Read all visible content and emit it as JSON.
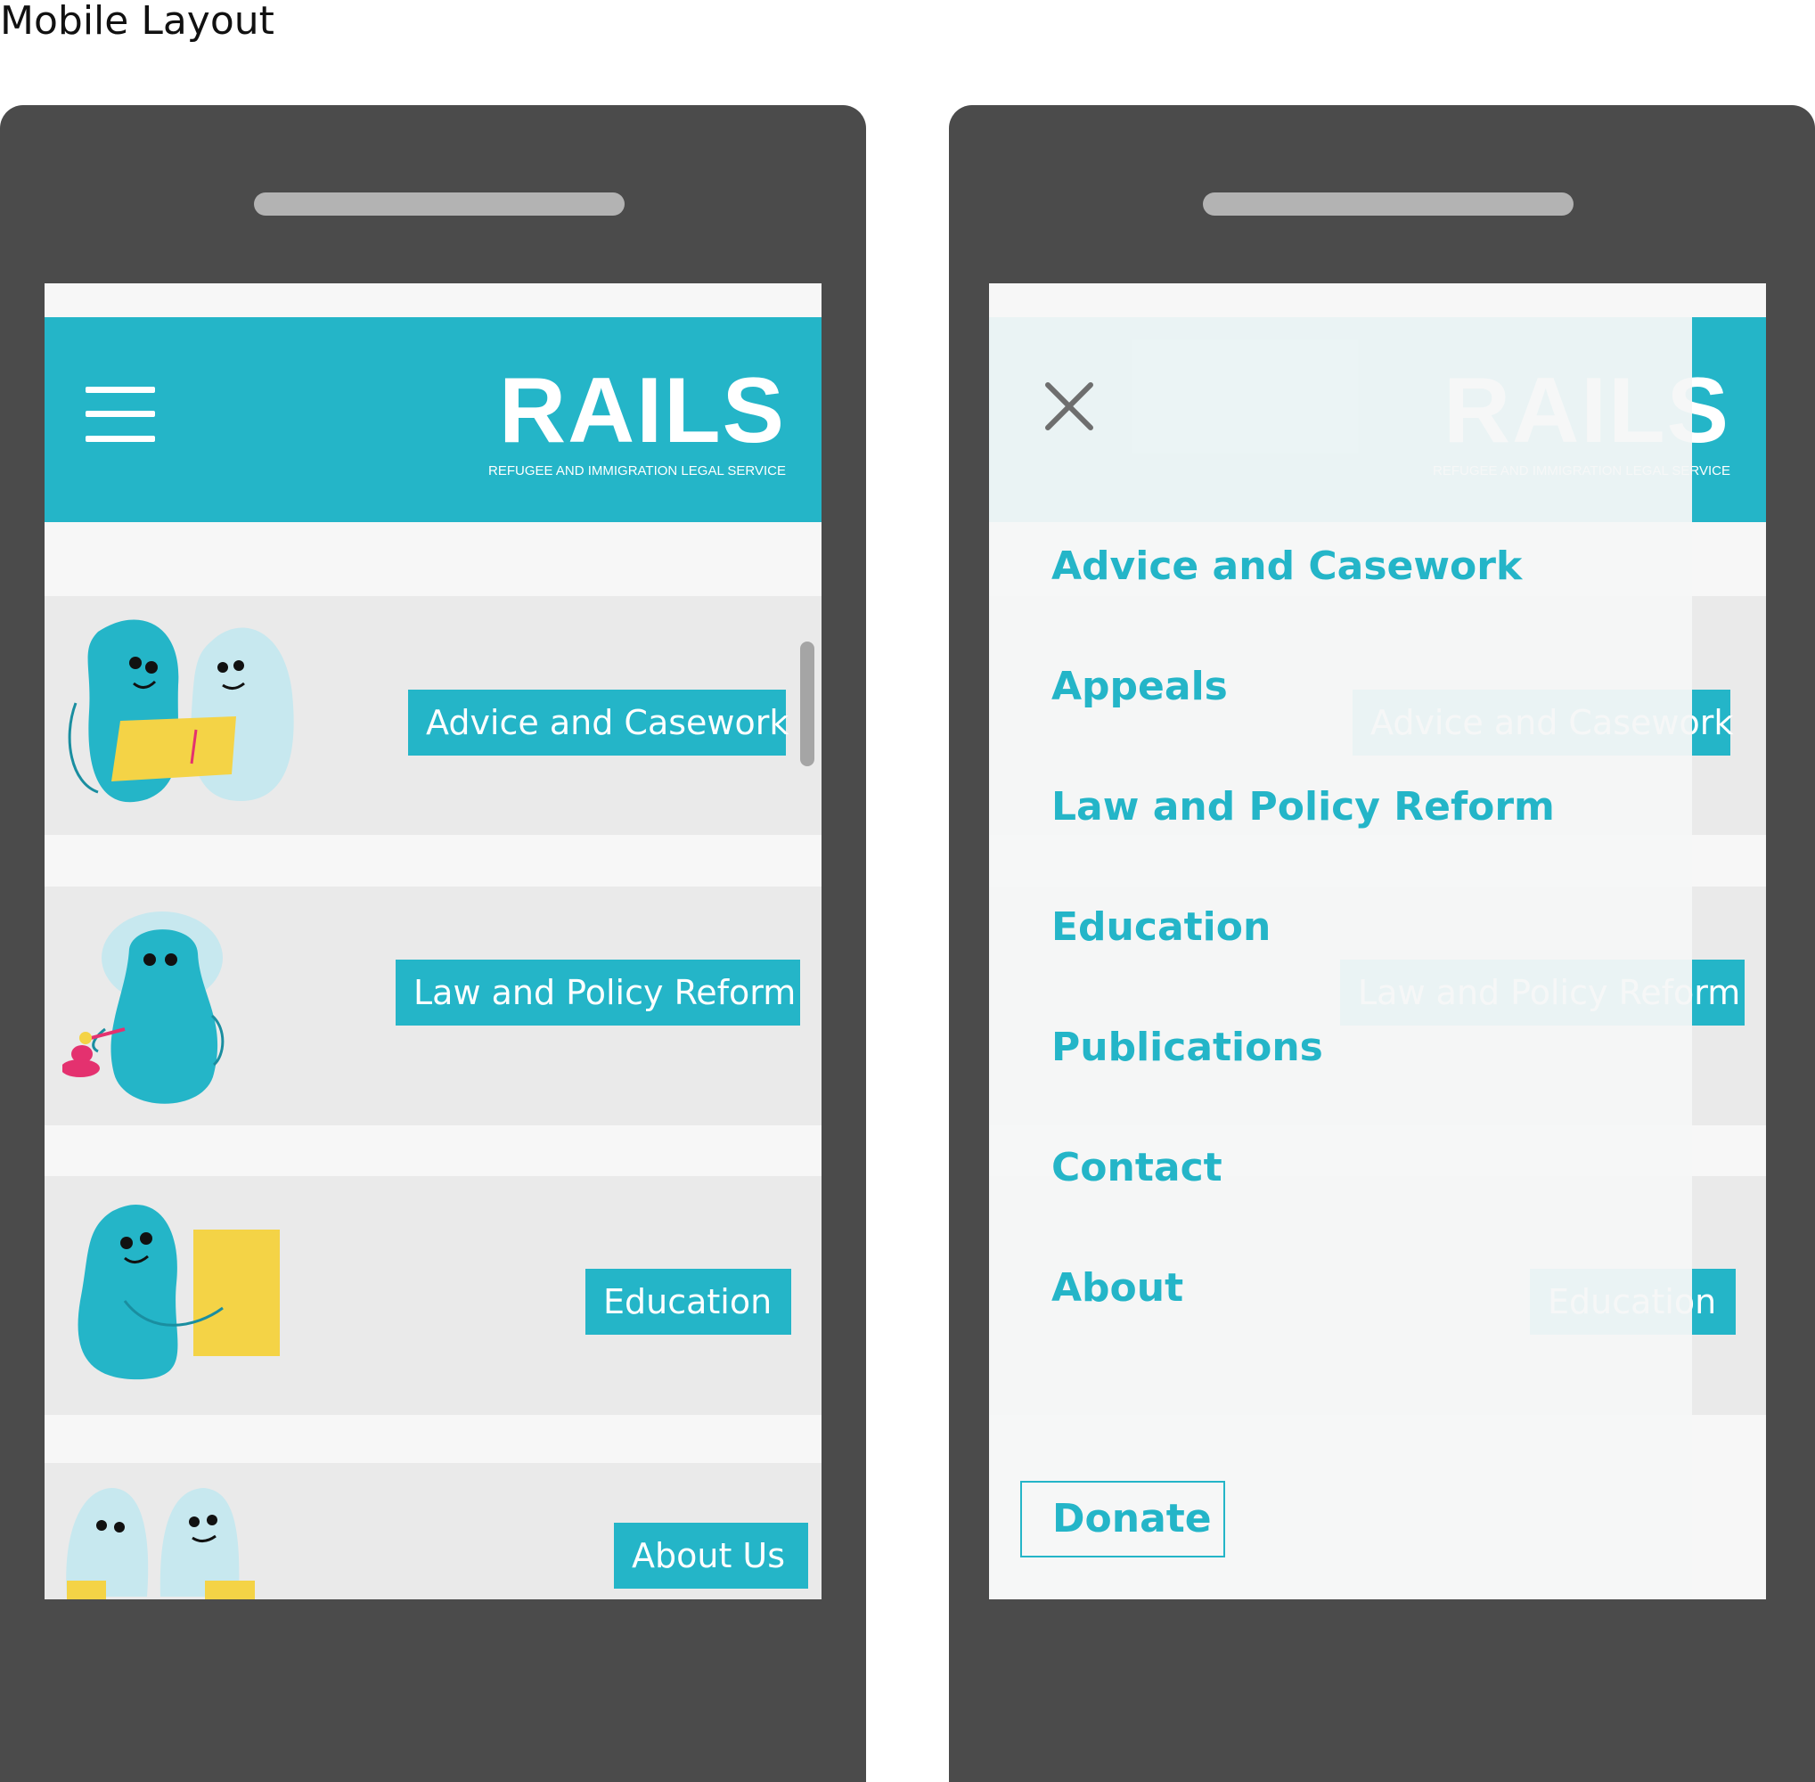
{
  "page": {
    "title": "Mobile Layout"
  },
  "header": {
    "logo": "RAILS",
    "tagline": "REFUGEE AND IMMIGRATION LEGAL SERVICE"
  },
  "cards": [
    {
      "label": "Advice and Casework"
    },
    {
      "label": "Law and Policy Reform"
    },
    {
      "label": "Education"
    },
    {
      "label": "About Us"
    }
  ],
  "menu": {
    "items": [
      {
        "label": "Advice and Casework"
      },
      {
        "label": "Appeals"
      },
      {
        "label": "Law and Policy Reform"
      },
      {
        "label": "Education"
      },
      {
        "label": "Publications"
      },
      {
        "label": "Contact"
      },
      {
        "label": "About"
      }
    ],
    "donate_label": "Donate"
  },
  "icons": {
    "menu": "hamburger-menu-icon",
    "close": "close-icon"
  },
  "colors": {
    "brand": "#24b5c8",
    "phone_body": "#4b4b4b",
    "card_bg": "#eaeaea",
    "screen_bg": "#f7f7f7",
    "folder": "#f4d346",
    "accent_pink": "#e4316f"
  }
}
